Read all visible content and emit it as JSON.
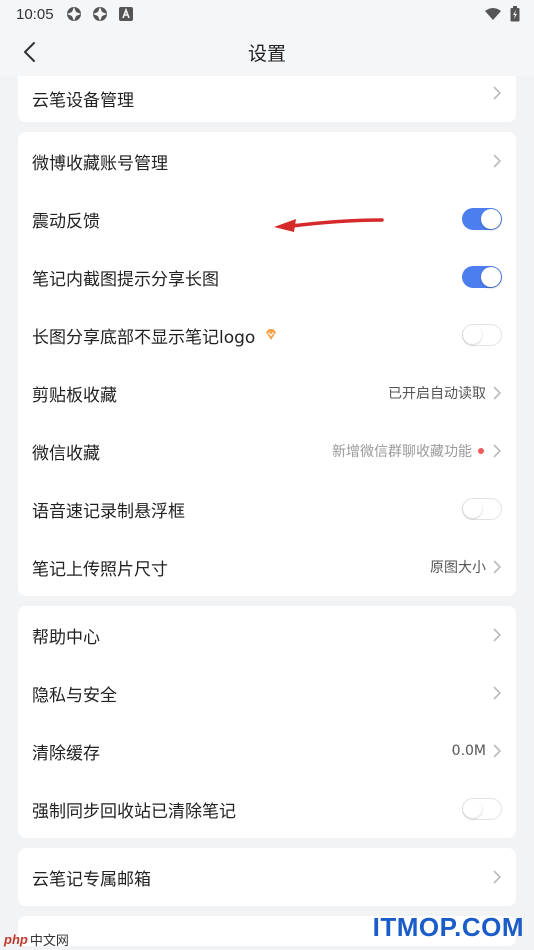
{
  "status_bar": {
    "time": "10:05",
    "icons": [
      "app-notification-icon",
      "app-notification-icon",
      "text-a-icon"
    ],
    "right_icons": [
      "wifi-icon",
      "battery-icon"
    ]
  },
  "header": {
    "title": "设置",
    "back_icon": "chevron-left-icon"
  },
  "sections": [
    {
      "rows": [
        {
          "label": "云笔设备管理",
          "type": "link"
        }
      ]
    },
    {
      "rows": [
        {
          "label": "微博收藏账号管理",
          "type": "link"
        },
        {
          "label": "震动反馈",
          "type": "toggle",
          "on": true
        },
        {
          "label": "笔记内截图提示分享长图",
          "type": "toggle",
          "on": true
        },
        {
          "label": "长图分享底部不显示笔记logo",
          "type": "toggle",
          "on": false,
          "icon": "vip-diamond-icon"
        },
        {
          "label": "剪贴板收藏",
          "type": "link",
          "value": "已开启自动读取"
        },
        {
          "label": "微信收藏",
          "type": "link",
          "value": "新增微信群聊收藏功能",
          "badge_dot": true
        },
        {
          "label": "语音速记录制悬浮框",
          "type": "toggle",
          "on": false
        },
        {
          "label": "笔记上传照片尺寸",
          "type": "link",
          "value": "原图大小"
        }
      ]
    },
    {
      "rows": [
        {
          "label": "帮助中心",
          "type": "link"
        },
        {
          "label": "隐私与安全",
          "type": "link"
        },
        {
          "label": "清除缓存",
          "type": "link",
          "value": "0.0M"
        },
        {
          "label": "强制同步回收站已清除笔记",
          "type": "toggle",
          "on": false
        }
      ]
    },
    {
      "rows": [
        {
          "label": "云笔记专属邮箱",
          "type": "link"
        }
      ]
    }
  ],
  "watermarks": {
    "left_logo": "php",
    "left_text": "中文网",
    "right_text": "ITMOP.COM"
  },
  "colors": {
    "toggle_on": "#4d7ef0",
    "background": "#f2f3f5",
    "card": "#ffffff",
    "annotation_arrow": "#d42a2a",
    "badge_dot": "#f25b5b",
    "vip_icon": "#f5a04a"
  }
}
